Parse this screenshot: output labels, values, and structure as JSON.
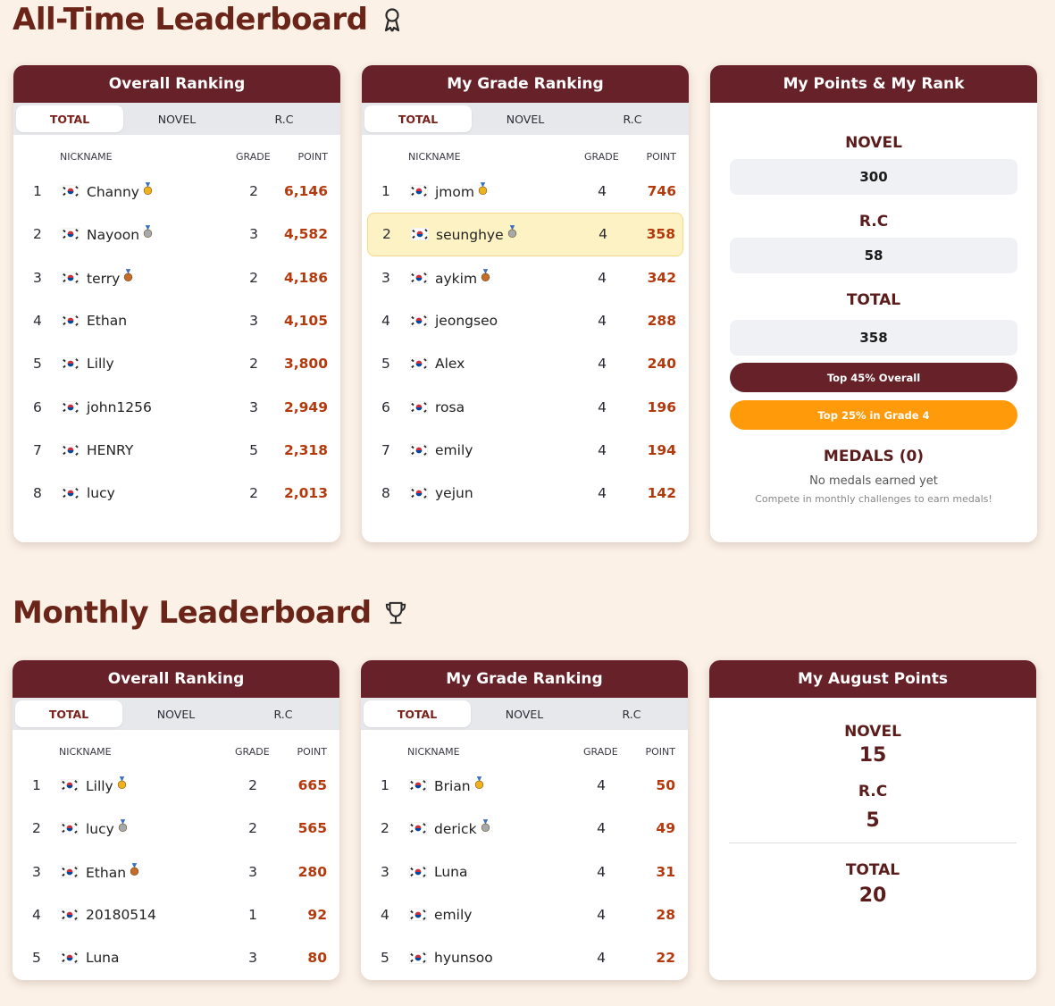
{
  "alltime": {
    "title": "All-Time Leaderboard",
    "icon": "ribbon-award-icon",
    "overall": {
      "header": "Overall Ranking",
      "tabs": [
        "TOTAL",
        "NOVEL",
        "R.C"
      ],
      "active_tab": "TOTAL",
      "columns": {
        "nickname": "NICKNAME",
        "grade": "GRADE",
        "point": "POINT"
      },
      "rows": [
        {
          "rank": "1",
          "nickname": "Channy",
          "medal": "gold",
          "grade": "2",
          "point": "6,146"
        },
        {
          "rank": "2",
          "nickname": "Nayoon",
          "medal": "silver",
          "grade": "3",
          "point": "4,582"
        },
        {
          "rank": "3",
          "nickname": "terry",
          "medal": "bronze",
          "grade": "2",
          "point": "4,186"
        },
        {
          "rank": "4",
          "nickname": "Ethan",
          "medal": "",
          "grade": "3",
          "point": "4,105"
        },
        {
          "rank": "5",
          "nickname": "Lilly",
          "medal": "",
          "grade": "2",
          "point": "3,800"
        },
        {
          "rank": "6",
          "nickname": "john1256",
          "medal": "",
          "grade": "3",
          "point": "2,949"
        },
        {
          "rank": "7",
          "nickname": "HENRY",
          "medal": "",
          "grade": "5",
          "point": "2,318"
        },
        {
          "rank": "8",
          "nickname": "lucy",
          "medal": "",
          "grade": "2",
          "point": "2,013"
        }
      ]
    },
    "grade": {
      "header": "My Grade Ranking",
      "tabs": [
        "TOTAL",
        "NOVEL",
        "R.C"
      ],
      "active_tab": "TOTAL",
      "columns": {
        "nickname": "NICKNAME",
        "grade": "GRADE",
        "point": "POINT"
      },
      "rows": [
        {
          "rank": "1",
          "nickname": "jmom",
          "medal": "gold",
          "grade": "4",
          "point": "746"
        },
        {
          "rank": "2",
          "nickname": "seunghye",
          "medal": "silver",
          "grade": "4",
          "point": "358",
          "highlight": true
        },
        {
          "rank": "3",
          "nickname": "aykim",
          "medal": "bronze",
          "grade": "4",
          "point": "342"
        },
        {
          "rank": "4",
          "nickname": "jeongseo",
          "medal": "",
          "grade": "4",
          "point": "288"
        },
        {
          "rank": "5",
          "nickname": "Alex",
          "medal": "",
          "grade": "4",
          "point": "240"
        },
        {
          "rank": "6",
          "nickname": "rosa",
          "medal": "",
          "grade": "4",
          "point": "196"
        },
        {
          "rank": "7",
          "nickname": "emily",
          "medal": "",
          "grade": "4",
          "point": "194"
        },
        {
          "rank": "8",
          "nickname": "yejun",
          "medal": "",
          "grade": "4",
          "point": "142"
        }
      ]
    },
    "mine": {
      "header": "My Points & My Rank",
      "novel_label": "NOVEL",
      "novel_value": "300",
      "rc_label": "R.C",
      "rc_value": "58",
      "total_label": "TOTAL",
      "total_value": "358",
      "overall_rank_pill": "Top 45% Overall",
      "grade_rank_pill": "Top 25% in Grade 4",
      "medals_label": "MEDALS (0)",
      "no_medals": "No medals earned yet",
      "compete_hint": "Compete in monthly challenges to earn medals!"
    }
  },
  "monthly": {
    "title": "Monthly Leaderboard",
    "icon": "trophy-icon",
    "overall": {
      "header": "Overall Ranking",
      "tabs": [
        "TOTAL",
        "NOVEL",
        "R.C"
      ],
      "active_tab": "TOTAL",
      "columns": {
        "nickname": "NICKNAME",
        "grade": "GRADE",
        "point": "POINT"
      },
      "rows": [
        {
          "rank": "1",
          "nickname": "Lilly",
          "medal": "gold",
          "grade": "2",
          "point": "665"
        },
        {
          "rank": "2",
          "nickname": "lucy",
          "medal": "silver",
          "grade": "2",
          "point": "565"
        },
        {
          "rank": "3",
          "nickname": "Ethan",
          "medal": "bronze",
          "grade": "3",
          "point": "280"
        },
        {
          "rank": "4",
          "nickname": "20180514",
          "medal": "",
          "grade": "1",
          "point": "92"
        },
        {
          "rank": "5",
          "nickname": "Luna",
          "medal": "",
          "grade": "3",
          "point": "80"
        }
      ]
    },
    "grade": {
      "header": "My Grade Ranking",
      "tabs": [
        "TOTAL",
        "NOVEL",
        "R.C"
      ],
      "active_tab": "TOTAL",
      "columns": {
        "nickname": "NICKNAME",
        "grade": "GRADE",
        "point": "POINT"
      },
      "rows": [
        {
          "rank": "1",
          "nickname": "Brian",
          "medal": "gold",
          "grade": "4",
          "point": "50"
        },
        {
          "rank": "2",
          "nickname": "derick",
          "medal": "silver",
          "grade": "4",
          "point": "49"
        },
        {
          "rank": "3",
          "nickname": "Luna",
          "medal": "",
          "grade": "4",
          "point": "31"
        },
        {
          "rank": "4",
          "nickname": "emily",
          "medal": "",
          "grade": "4",
          "point": "28"
        },
        {
          "rank": "5",
          "nickname": "hyunsoo",
          "medal": "",
          "grade": "4",
          "point": "22"
        }
      ]
    },
    "mine": {
      "header": "My August Points",
      "novel_label": "NOVEL",
      "novel_value": "15",
      "rc_label": "R.C",
      "rc_value": "5",
      "total_label": "TOTAL",
      "total_value": "20"
    }
  },
  "colors": {
    "background": "#fbf1e7",
    "header": "#662129",
    "title": "#6b2418",
    "point": "#b43a0e",
    "overall_pill": "#662129",
    "grade_pill": "#ff9a0a",
    "highlight_row": "#fdf2c4"
  }
}
